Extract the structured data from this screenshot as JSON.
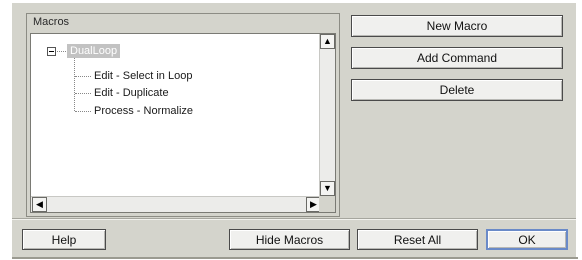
{
  "macros": {
    "group_label": "Macros",
    "tree": {
      "root": "DualLoop",
      "children": [
        "Edit - Select in Loop",
        "Edit - Duplicate",
        "Process - Normalize"
      ]
    }
  },
  "side_buttons": {
    "new_macro": "New Macro",
    "add_command": "Add Command",
    "delete": "Delete"
  },
  "footer_buttons": {
    "help": "Help",
    "hide_macros": "Hide Macros",
    "reset_all": "Reset All",
    "ok": "OK"
  },
  "scroll_glyphs": {
    "up": "▲",
    "down": "▼",
    "left": "◀",
    "right": "▶"
  }
}
